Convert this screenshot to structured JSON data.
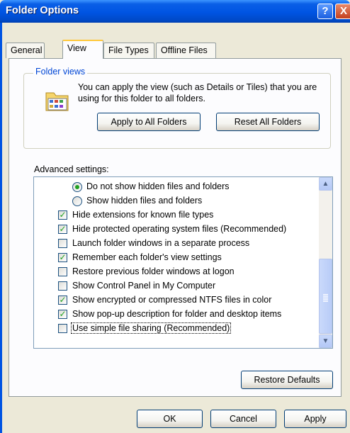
{
  "window": {
    "title": "Folder Options",
    "help_label": "?",
    "close_label": "X"
  },
  "tabs": [
    {
      "label": "General",
      "active": false
    },
    {
      "label": "View",
      "active": true
    },
    {
      "label": "File Types",
      "active": false
    },
    {
      "label": "Offline Files",
      "active": false
    }
  ],
  "folder_views": {
    "legend": "Folder views",
    "description": "You can apply the view (such as Details or Tiles) that you are using for this folder to all folders.",
    "apply_label": "Apply to All Folders",
    "reset_label": "Reset All Folders"
  },
  "advanced": {
    "label": "Advanced settings:",
    "items": [
      {
        "type": "radio",
        "checked": true,
        "label": "Do not show hidden files and folders"
      },
      {
        "type": "radio",
        "checked": false,
        "label": "Show hidden files and folders"
      },
      {
        "type": "check",
        "checked": true,
        "label": "Hide extensions for known file types"
      },
      {
        "type": "check",
        "checked": true,
        "label": "Hide protected operating system files (Recommended)"
      },
      {
        "type": "check",
        "checked": false,
        "label": "Launch folder windows in a separate process"
      },
      {
        "type": "check",
        "checked": true,
        "label": "Remember each folder's view settings"
      },
      {
        "type": "check",
        "checked": false,
        "label": "Restore previous folder windows at logon"
      },
      {
        "type": "check",
        "checked": false,
        "label": "Show Control Panel in My Computer"
      },
      {
        "type": "check",
        "checked": true,
        "label": "Show encrypted or compressed NTFS files in color"
      },
      {
        "type": "check",
        "checked": true,
        "label": "Show pop-up description for folder and desktop items"
      },
      {
        "type": "check",
        "checked": false,
        "label": "Use simple file sharing (Recommended)"
      }
    ],
    "restore_label": "Restore Defaults"
  },
  "footer": {
    "ok_label": "OK",
    "cancel_label": "Cancel",
    "apply_label": "Apply"
  },
  "colors": {
    "titlebar": "#0054e3",
    "dialog_bg": "#ece9d8",
    "check_mark": "#21a121",
    "legend_text": "#0046d5"
  }
}
